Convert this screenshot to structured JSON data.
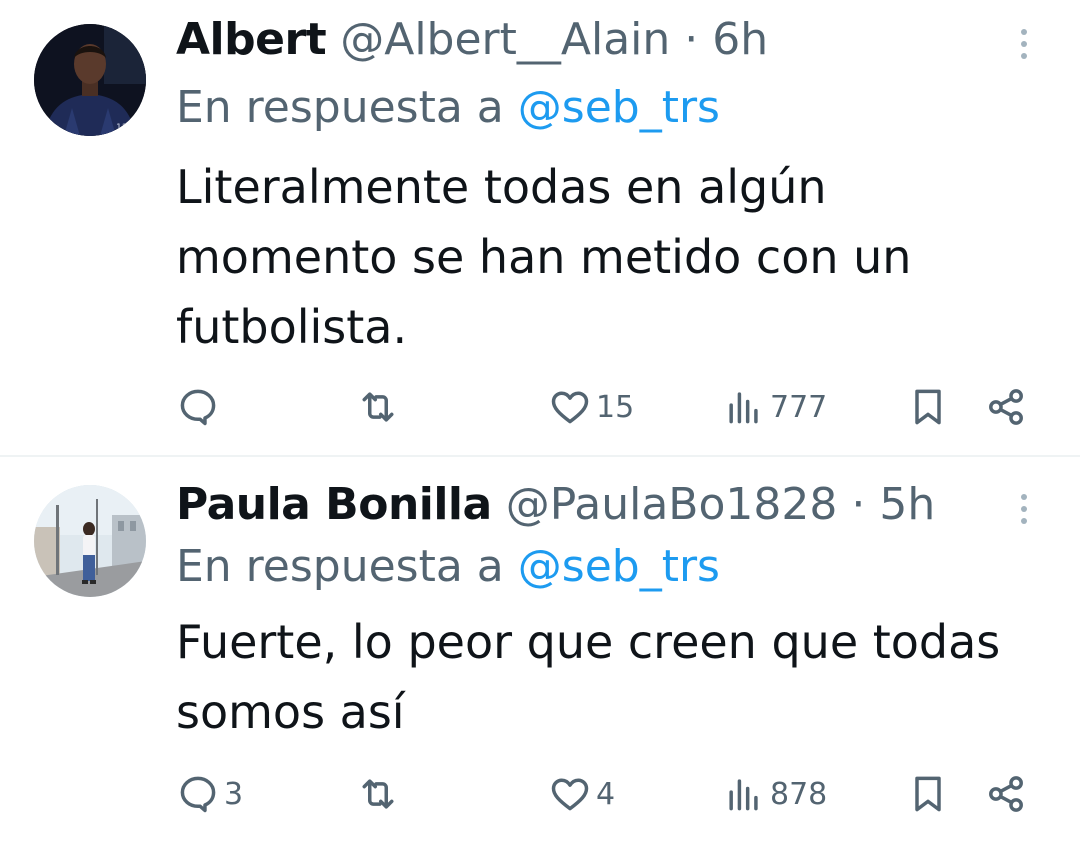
{
  "colors": {
    "text_primary": "#0f1419",
    "text_secondary": "#536471",
    "link": "#1d9bf0",
    "divider": "#eff3f4"
  },
  "tweets": [
    {
      "name": "Albert",
      "handle": "@Albert__Alain",
      "separator": "·",
      "time": "6h",
      "reply_prefix": "En respuesta a",
      "reply_to": "@seb_trs",
      "text": "Literalmente todas en algún momento se han metido con un futbolista.",
      "counts": {
        "replies": "",
        "retweets": "",
        "likes": "15",
        "views": "777"
      },
      "icons": [
        "reply-icon",
        "retweet-icon",
        "heart-icon",
        "views-icon",
        "bookmark-icon",
        "share-icon",
        "more-icon"
      ]
    },
    {
      "name": "Paula Bonilla",
      "handle": "@PaulaBo1828",
      "separator": "·",
      "time": "5h",
      "reply_prefix": "En respuesta a",
      "reply_to": "@seb_trs",
      "text": "Fuerte, lo peor que creen que todas somos así",
      "counts": {
        "replies": "3",
        "retweets": "",
        "likes": "4",
        "views": "878"
      },
      "icons": [
        "reply-icon",
        "retweet-icon",
        "heart-icon",
        "views-icon",
        "bookmark-icon",
        "share-icon",
        "more-icon"
      ]
    }
  ]
}
